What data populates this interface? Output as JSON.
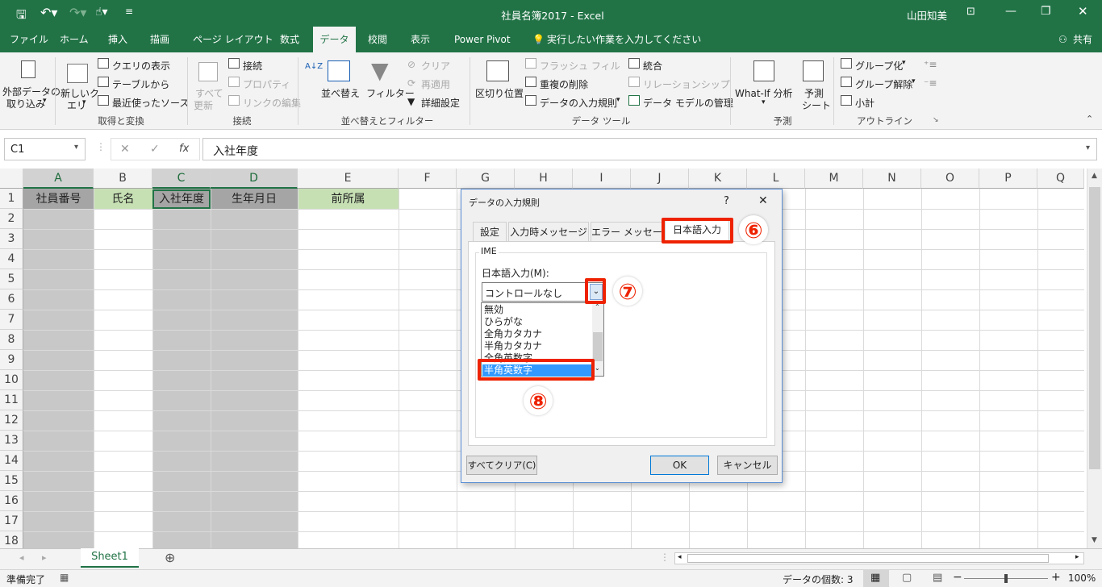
{
  "window": {
    "title": "社員名簿2017  -  Excel",
    "user": "山田知美"
  },
  "tabs": [
    "ファイル",
    "ホーム",
    "挿入",
    "描画",
    "ページ レイアウト",
    "数式",
    "データ",
    "校閲",
    "表示",
    "Power Pivot"
  ],
  "tell_me": "実行したい作業を入力してください",
  "share": "共有",
  "ribbon": {
    "external_data": "外部データの",
    "external_data2": "取り込み",
    "new_query": "新しいク",
    "new_query2": "エリ",
    "show_queries": "クエリの表示",
    "from_table": "テーブルから",
    "recent_sources": "最近使ったソース",
    "refresh_all": "すべて",
    "refresh_all2": "更新",
    "connections": "接続",
    "properties": "プロパティ",
    "edit_links": "リンクの編集",
    "sort_az": "A↓Z",
    "sort": "並べ替え",
    "filter": "フィルター",
    "clear": "クリア",
    "reapply": "再適用",
    "advanced": "詳細設定",
    "text_to_columns": "区切り位置",
    "flash_fill": "フラッシュ フィル",
    "remove_duplicates": "重複の削除",
    "data_validation": "データの入力規則",
    "consolidate": "統合",
    "relationships": "リレーションシップ",
    "data_model": "データ モデルの管理",
    "what_if": "What-If 分析",
    "forecast_sheet": "予測",
    "forecast_sheet2": "シート",
    "group": "グループ化",
    "ungroup": "グループ解除",
    "subtotal": "小計",
    "groups": [
      "取得と変換",
      "接続",
      "並べ替えとフィルター",
      "データ ツール",
      "予測",
      "アウトライン"
    ]
  },
  "formula_bar": {
    "name_box": "C1",
    "cancel": "✕",
    "enter": "✓",
    "fx": "fx",
    "content": "入社年度"
  },
  "columns": [
    "A",
    "B",
    "C",
    "D",
    "E",
    "F",
    "G",
    "H",
    "I",
    "J",
    "K",
    "L",
    "M",
    "N",
    "O",
    "P",
    "Q"
  ],
  "rows": [
    "1",
    "2",
    "3",
    "4",
    "5",
    "6",
    "7",
    "8",
    "9",
    "10",
    "11",
    "12",
    "13",
    "14",
    "15",
    "16",
    "17",
    "18"
  ],
  "header_cells": [
    "社員番号",
    "氏名",
    "入社年度",
    "生年月日",
    "前所属"
  ],
  "sheet_tab": "Sheet1",
  "status": {
    "ready": "準備完了",
    "count": "データの個数: 3",
    "zoom": "100%",
    "minus": "−",
    "plus": "+"
  },
  "dialog": {
    "title": "データの入力規則",
    "help": "?",
    "close": "✕",
    "tabs": [
      "設定",
      "入力時メッセージ",
      "エラー メッセージ",
      "日本語入力"
    ],
    "ime_group": "IME",
    "mode_label": "日本語入力(M):",
    "combo_value": "コントロールなし",
    "list": [
      "無効",
      "ひらがな",
      "全角カタカナ",
      "半角カタカナ",
      "全角英数字",
      "半角英数字"
    ],
    "selected": "半角英数字",
    "clear_all": "すべてクリア(C)",
    "ok": "OK",
    "cancel": "キャンセル"
  },
  "annotations": [
    "⑥",
    "⑦",
    "⑧"
  ],
  "colors": {
    "excel_green": "#217346",
    "highlight_red": "#ee2200",
    "selection_blue": "#3399ff",
    "gray_fill": "#c8c8c8",
    "green_fill": "#c6e0b4"
  }
}
